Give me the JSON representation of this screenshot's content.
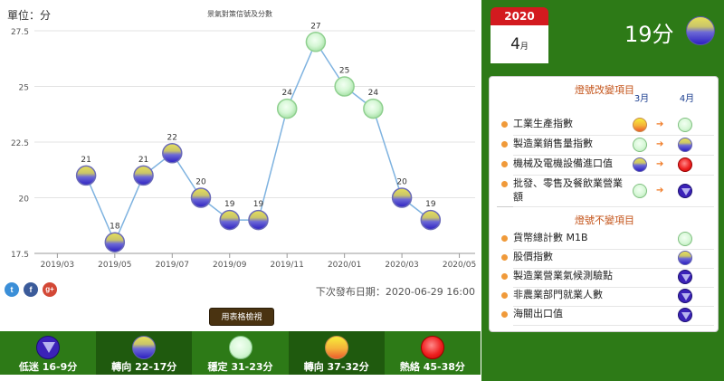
{
  "header": {
    "unit_label": "單位：分",
    "title": "景氣對策信號及分數"
  },
  "chart_data": {
    "type": "line",
    "title": "景氣對策信號及分數",
    "ylabel": "單位：分",
    "xlabel": "",
    "ylim": [
      17.5,
      27.5
    ],
    "y_ticks": [
      "17.5",
      "20",
      "22.5",
      "25",
      "27.5"
    ],
    "x_ticks": [
      "2019/03",
      "2019/05",
      "2019/07",
      "2019/09",
      "2019/11",
      "2020/01",
      "2020/03",
      "2020/05"
    ],
    "x": [
      "2019/04",
      "2019/05",
      "2019/06",
      "2019/07",
      "2019/08",
      "2019/09",
      "2019/10",
      "2019/11",
      "2019/12",
      "2020/01",
      "2020/02",
      "2020/03",
      "2020/04"
    ],
    "values": [
      21,
      18,
      21,
      22,
      20,
      19,
      19,
      24,
      27,
      25,
      24,
      20,
      19
    ],
    "signals": [
      "blue",
      "blue",
      "blue",
      "blue",
      "blue",
      "blue",
      "blue",
      "green",
      "green",
      "green",
      "green",
      "blue",
      "blue"
    ],
    "grid": true,
    "line_color": "#7fb3e0"
  },
  "footer": {
    "next_release": "下次發布日期：2020-06-29 16:00",
    "table_button": "用表格檢視"
  },
  "social": {
    "twitter": "t",
    "facebook": "f",
    "google": "g+"
  },
  "legend": [
    {
      "label": "低迷 16-9分",
      "icon": "blue-down-triangle",
      "bg": "#2d7a17"
    },
    {
      "label": "轉向 22-17分",
      "icon": "yellow-blue-lamp",
      "bg": "#1f5a0e"
    },
    {
      "label": "穩定 31-23分",
      "icon": "green-lamp",
      "bg": "#2d7a17"
    },
    {
      "label": "轉向 37-32分",
      "icon": "yellow-red-lamp",
      "bg": "#1f5a0e"
    },
    {
      "label": "熱絡 45-38分",
      "icon": "red-lamp",
      "bg": "#2d7a17"
    }
  ],
  "summary": {
    "year": "2020",
    "month": "4",
    "month_unit": "月",
    "score": "19分",
    "score_icon": "yellow-blue-lamp"
  },
  "signals_panel": {
    "changed_title": "燈號改變項目",
    "unchanged_title": "燈號不變項目",
    "col_prev": "3月",
    "col_curr": "4月",
    "changed": [
      {
        "name": "工業生產指數",
        "prev": "yellowred",
        "curr": "green"
      },
      {
        "name": "製造業銷售量指數",
        "prev": "green",
        "curr": "blue"
      },
      {
        "name": "機械及電機設備進口值",
        "prev": "blue",
        "curr": "red"
      },
      {
        "name": "批發、零售及餐飲業營業額",
        "prev": "green",
        "curr": "down"
      }
    ],
    "unchanged": [
      {
        "name": "貨幣總計數 M1B",
        "curr": "green"
      },
      {
        "name": "股價指數",
        "curr": "blue"
      },
      {
        "name": "製造業營業氣候測驗點",
        "curr": "down"
      },
      {
        "name": "非農業部門就業人數",
        "curr": "down"
      },
      {
        "name": "海關出口值",
        "curr": "down"
      }
    ],
    "arrow": "➔"
  }
}
